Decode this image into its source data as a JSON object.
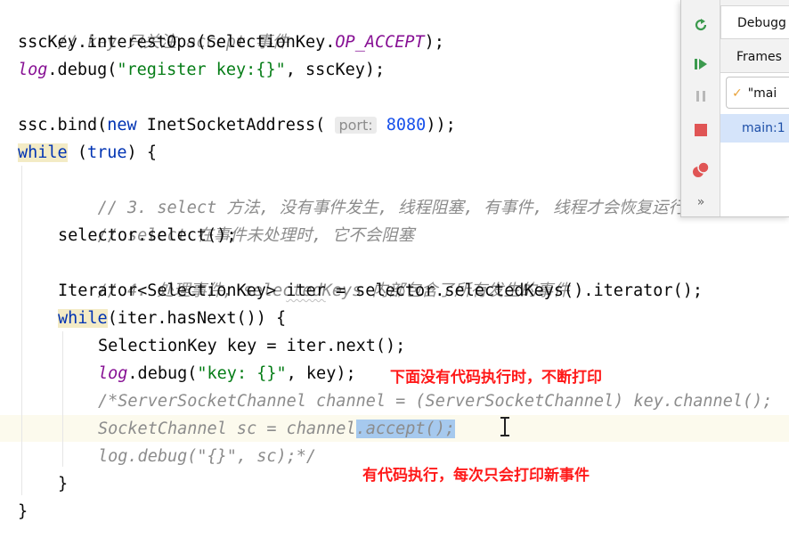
{
  "editor": {
    "lines": {
      "l1": {
        "comment": "// key 只关注 accept 事件"
      },
      "l2": {
        "a": "sscKey.interestOps(SelectionKey.",
        "const": "OP_ACCEPT",
        "b": ");"
      },
      "l3": {
        "log": "log",
        "a": ".debug(",
        "str": "\"register key:{}\"",
        "b": ", sscKey);"
      },
      "l5": {
        "a": "ssc.bind(",
        "kw": "new",
        "b": " InetSocketAddress( ",
        "hint": "port:",
        "num": "8080",
        "c": "));"
      },
      "l6": {
        "kw": "while",
        "a": " (",
        "kw2": "true",
        "b": ") {"
      },
      "l7": {
        "comment": "// 3. select 方法, 没有事件发生, 线程阻塞, 有事件, 线程才会恢复运行"
      },
      "l8": {
        "comment": "// select 在事件未处理时, 它不会阻塞"
      },
      "l9": {
        "a": "selector.select();"
      },
      "l10": {
        "comment": "// 4. 处理事件, selectedKeys 内部包含了所有发生的事件"
      },
      "l11": {
        "a": "Iterator<SelectionKey> ",
        "b": "iter",
        "c": " = selector.selectedKeys().iterator();"
      },
      "l12": {
        "kw": "while",
        "a": "(iter.hasNext()) {"
      },
      "l13": {
        "a": "SelectionKey key = iter.next();"
      },
      "l14": {
        "log": "log",
        "a": ".debug(",
        "str": "\"key: {}\"",
        "b": ", key);"
      },
      "l15": {
        "a": "/*ServerSocketChannel channel = (ServerSocketChannel) key.channel();"
      },
      "l16": {
        "a": "SocketChannel sc = channel",
        "sel": ".accept();"
      },
      "l17": {
        "a": "log.debug(\"{}\", sc);*/"
      },
      "l18": {
        "a": "}"
      },
      "l19": {
        "a": "}"
      }
    },
    "notes": {
      "n1": "下面没有代码执行时，不断打印",
      "n2": "有代码执行，每次只会打印新事件"
    }
  },
  "debug_panel": {
    "tab_label": "Debugg",
    "frames_label": "Frames",
    "thread_label": "\"mai",
    "frame_item": "main:1",
    "more": "»"
  },
  "colors": {
    "comment": "#8c8c8c",
    "keyword": "#0033b3",
    "string": "#067d17",
    "number": "#1750eb",
    "constant": "#871094",
    "selection": "#a6c9ee",
    "annotation": "#ff1a1a",
    "current_line": "#fcfaed",
    "frame_selected": "#d5e4fa"
  }
}
